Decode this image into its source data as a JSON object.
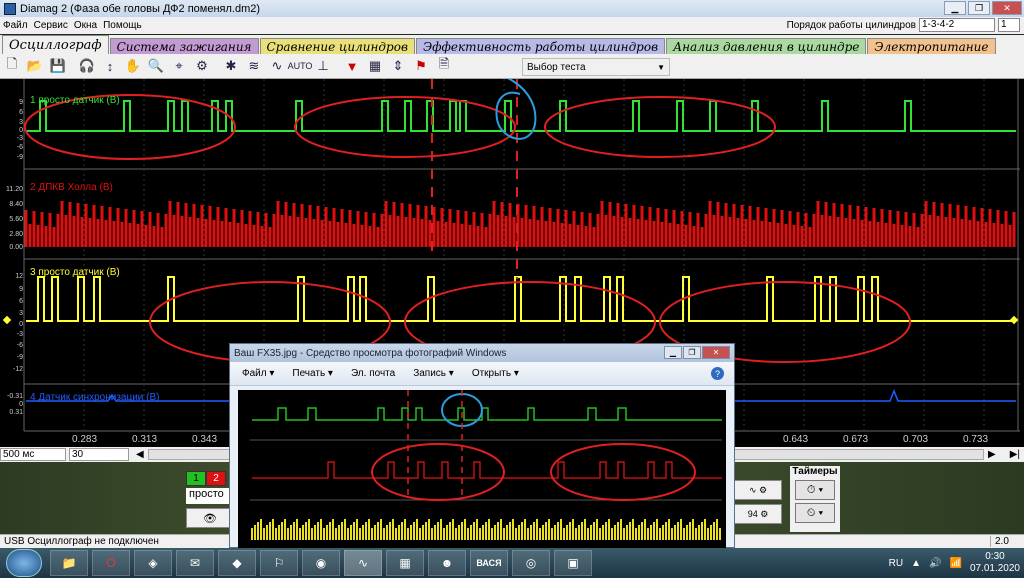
{
  "window": {
    "title": "Diamag 2 (Фаза обе головы ДФ2 поменял.dm2)"
  },
  "menu": [
    "Файл",
    "Сервис",
    "Окна",
    "Помощь"
  ],
  "cylinder_order": {
    "label": "Порядок работы цилиндров",
    "value": "1-3-4-2",
    "count": "1"
  },
  "tabs": [
    {
      "label": "Осциллограф",
      "color": "#f0f0f0"
    },
    {
      "label": "Система зажигания",
      "color": "#c39bd3"
    },
    {
      "label": "Сравнение цилиндров",
      "color": "#e9e07a"
    },
    {
      "label": "Эффективность работы цилиндров",
      "color": "#b9b9e8"
    },
    {
      "label": "Анализ давления в цилиндре",
      "color": "#a9d9a0"
    },
    {
      "label": "Электропитание",
      "color": "#f2c28e"
    }
  ],
  "toolbar": {
    "test_select": "Выбор теста"
  },
  "channels": [
    {
      "label": "1 просто датчик (В)",
      "color": "#33e333",
      "yticks": [
        "9",
        "6",
        "3",
        "0",
        "-3",
        "-6",
        "-9"
      ]
    },
    {
      "label": "2 ДПКВ Холла (В)",
      "color": "#e01010",
      "yticks": [
        "11.20",
        "8.40",
        "5.60",
        "2.80",
        "0.00"
      ]
    },
    {
      "label": "3 просто датчик (В)",
      "color": "#ffff33",
      "yticks": [
        "12",
        "9",
        "6",
        "3",
        "0",
        "-3",
        "-6",
        "-9",
        "-12"
      ]
    },
    {
      "label": "4 Датчик синхронизации (В)",
      "color": "#1f5fff",
      "yticks": [
        "-0.31",
        "0",
        "0.31"
      ]
    }
  ],
  "xaxis": {
    "ticks": [
      "0.283",
      "0.313",
      "0.343",
      "0.643",
      "0.673",
      "0.703",
      "0.733"
    ]
  },
  "scroll_row": {
    "timebase": "500 мс",
    "count": "30"
  },
  "bottom": {
    "ch1": "1",
    "ch2": "2",
    "sensor_label": "просто",
    "timers_label": "Таймеры"
  },
  "status": {
    "text": "USB Осциллограф не подключен",
    "version": "2.0"
  },
  "viewer": {
    "title": "Ваш FX35.jpg - Средство просмотра фотографий Windows",
    "menu": [
      "Файл ▾",
      "Печать ▾",
      "Эл. почта",
      "Запись ▾",
      "Открыть ▾"
    ]
  },
  "taskbar": {
    "lang": "RU",
    "time": "0:30",
    "date": "07.01.2020",
    "vasya": "ВАСЯ"
  }
}
